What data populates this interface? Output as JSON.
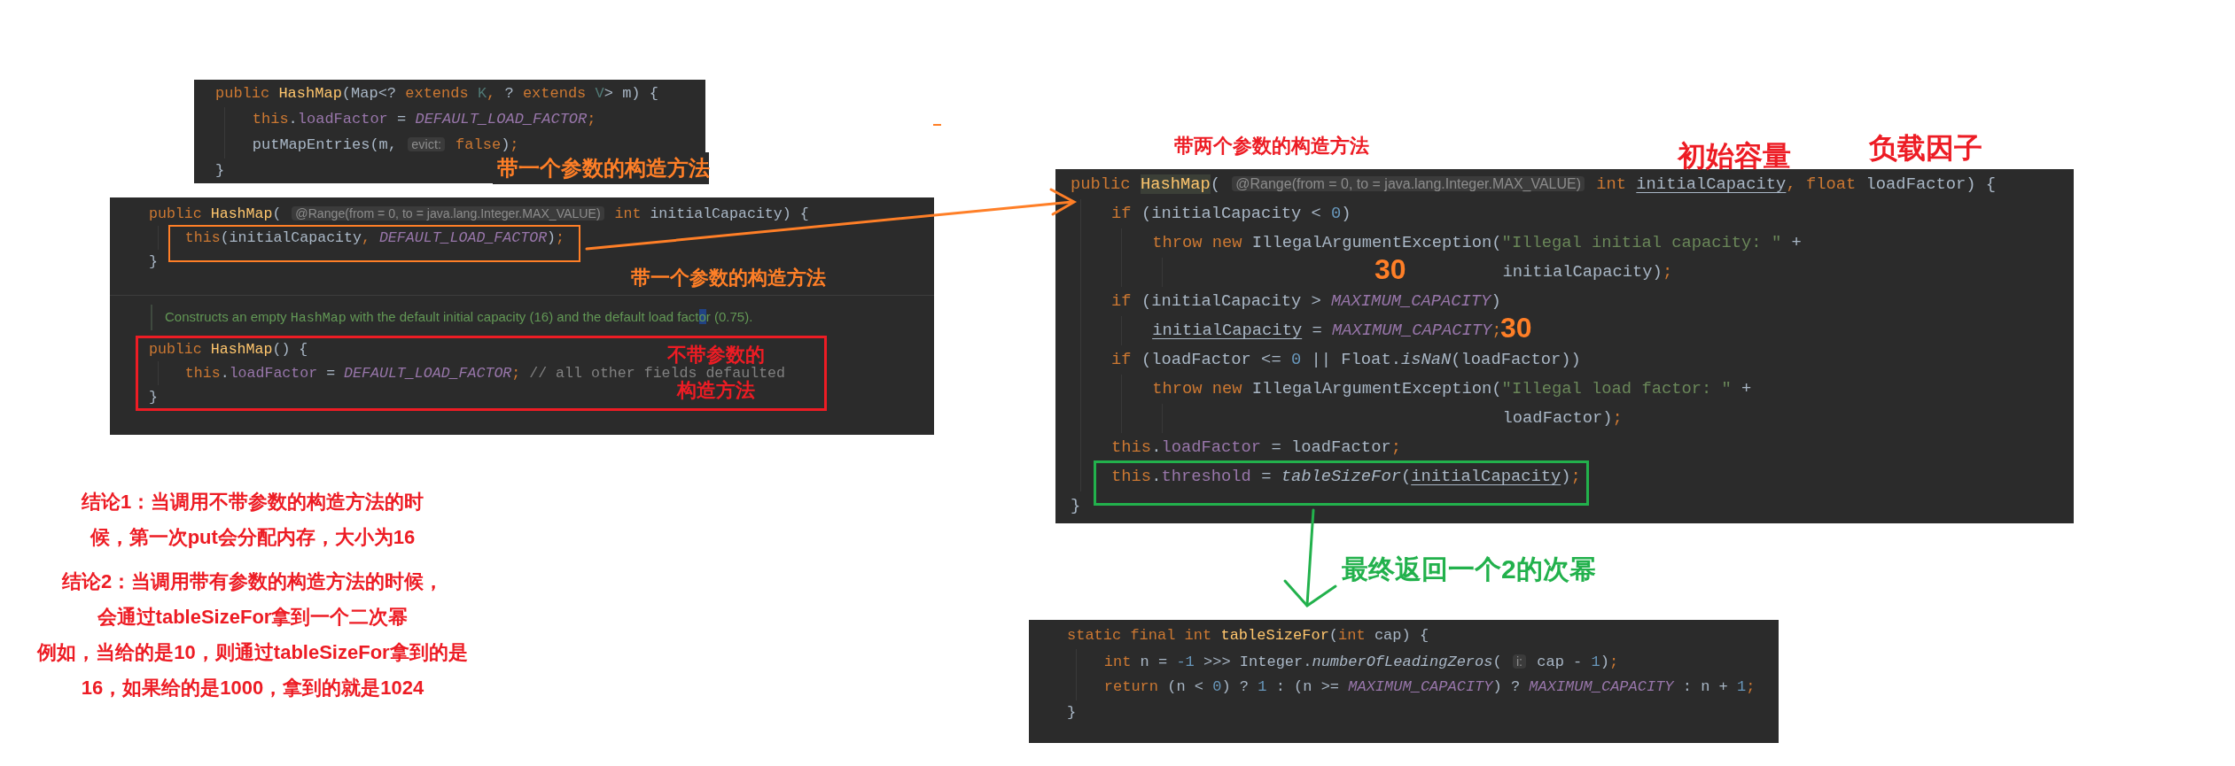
{
  "snippets": [
    {
      "lines": [
        {
          "kind": "code",
          "tokens": [
            {
              "kind": "keyword",
              "text": "public "
            },
            {
              "kind": "method",
              "text": "HashMap"
            },
            {
              "kind": "plain",
              "text": "(Map<? "
            },
            {
              "kind": "keyword",
              "text": "extends "
            },
            {
              "kind": "typeparam",
              "text": "K"
            },
            {
              "kind": "keyword",
              "text": ", "
            },
            {
              "kind": "plain",
              "text": "? "
            },
            {
              "kind": "keyword",
              "text": "extends "
            },
            {
              "kind": "typeparam",
              "text": "V"
            },
            {
              "kind": "plain",
              "text": "> m) {"
            }
          ],
          "children": [
            {
              "kind": "code",
              "tokens": [
                {
                  "kind": "keyword",
                  "text": "this"
                },
                {
                  "kind": "plain",
                  "text": "."
                },
                {
                  "kind": "field",
                  "text": "loadFactor"
                },
                {
                  "kind": "plain",
                  "text": " = "
                },
                {
                  "kind": "constant",
                  "text": "DEFAULT_LOAD_FACTOR"
                },
                {
                  "kind": "keyword",
                  "text": ";"
                }
              ]
            },
            {
              "kind": "code",
              "tokens": [
                {
                  "kind": "plain",
                  "text": "putMapEntries(m, "
                },
                {
                  "kind": "hint",
                  "text": "evict:"
                },
                {
                  "kind": "keyword",
                  "text": " false"
                },
                {
                  "kind": "plain",
                  "text": ")"
                },
                {
                  "kind": "keyword",
                  "text": ";"
                }
              ]
            }
          ]
        },
        {
          "kind": "code",
          "tokens": [
            {
              "kind": "plain",
              "text": "}"
            }
          ]
        }
      ]
    },
    {
      "lines": [
        {
          "kind": "code",
          "tokens": [
            {
              "kind": "keyword",
              "text": "public "
            },
            {
              "kind": "method",
              "text": "HashMap"
            },
            {
              "kind": "plain",
              "text": "( "
            },
            {
              "kind": "hint",
              "text": "@Range(from = 0, to = java.lang.Integer.MAX_VALUE)"
            },
            {
              "kind": "keyword",
              "text": " int"
            },
            {
              "kind": "plain",
              "text": " initialCapacity) {"
            }
          ],
          "children": [
            {
              "kind": "code",
              "tokens": [
                {
                  "kind": "keyword",
                  "text": "this"
                },
                {
                  "kind": "plain",
                  "text": "(initialCapacity"
                },
                {
                  "kind": "keyword",
                  "text": ", "
                },
                {
                  "kind": "constant",
                  "text": "DEFAULT_LOAD_FACTOR"
                },
                {
                  "kind": "plain",
                  "text": ")"
                },
                {
                  "kind": "keyword",
                  "text": ";"
                }
              ]
            }
          ]
        },
        {
          "kind": "code",
          "tokens": [
            {
              "kind": "plain",
              "text": "}"
            }
          ]
        },
        {
          "kind": "doc",
          "tokens": [
            {
              "kind": "doc",
              "text": "Constructs an empty "
            },
            {
              "kind": "doc_code",
              "text": "HashMap"
            },
            {
              "kind": "doc",
              "text": " with the default initial capacity (16) and the default load fact"
            },
            {
              "kind": "caret",
              "text": "o"
            },
            {
              "kind": "doc",
              "text": "r (0.75)."
            }
          ]
        },
        {
          "kind": "code",
          "tokens": [
            {
              "kind": "keyword",
              "text": "public "
            },
            {
              "kind": "method",
              "text": "HashMap"
            },
            {
              "kind": "plain",
              "text": "() {"
            }
          ],
          "children": [
            {
              "kind": "code",
              "tokens": [
                {
                  "kind": "keyword",
                  "text": "this"
                },
                {
                  "kind": "plain",
                  "text": "."
                },
                {
                  "kind": "field",
                  "text": "loadFactor"
                },
                {
                  "kind": "plain",
                  "text": " = "
                },
                {
                  "kind": "constant",
                  "text": "DEFAULT_LOAD_FACTOR"
                },
                {
                  "kind": "keyword",
                  "text": ";"
                },
                {
                  "kind": "comment",
                  "text": " // all other fields defaulted"
                }
              ]
            }
          ]
        },
        {
          "kind": "code",
          "tokens": [
            {
              "kind": "plain",
              "text": "}"
            }
          ]
        }
      ]
    },
    {
      "lines": [
        {
          "kind": "code",
          "tokens": [
            {
              "kind": "keyword",
              "text": "public "
            },
            {
              "kind": "method_highlight",
              "text": "HashMap"
            },
            {
              "kind": "plain",
              "text": "( "
            },
            {
              "kind": "hint",
              "text": "@Range(from = 0, to = java.lang.Integer.MAX_VALUE)"
            },
            {
              "kind": "keyword",
              "text": " int "
            },
            {
              "kind": "param",
              "text": "initialCapacity"
            },
            {
              "kind": "keyword",
              "text": ", float "
            },
            {
              "kind": "plain",
              "text": "loadFactor) {"
            }
          ],
          "children": [
            {
              "kind": "code",
              "tokens": [
                {
                  "kind": "keyword",
                  "text": "if "
                },
                {
                  "kind": "plain",
                  "text": "(initialCapacity < "
                },
                {
                  "kind": "number",
                  "text": "0"
                },
                {
                  "kind": "plain",
                  "text": ")"
                }
              ],
              "children": [
                {
                  "kind": "code",
                  "tokens": [
                    {
                      "kind": "keyword",
                      "text": "throw new "
                    },
                    {
                      "kind": "plain",
                      "text": "IllegalArgumentException("
                    },
                    {
                      "kind": "string",
                      "text": "\"Illegal initial capacity: \""
                    },
                    {
                      "kind": "plain",
                      "text": " +"
                    }
                  ],
                  "children": [
                    {
                      "kind": "continuation",
                      "tokens": [
                        {
                          "kind": "plain",
                          "text": "initialCapacity)"
                        },
                        {
                          "kind": "keyword",
                          "text": ";"
                        }
                      ]
                    }
                  ]
                }
              ]
            },
            {
              "kind": "code",
              "tokens": [
                {
                  "kind": "keyword",
                  "text": "if "
                },
                {
                  "kind": "plain",
                  "text": "(initialCapacity > "
                },
                {
                  "kind": "constant",
                  "text": "MAXIMUM_CAPACITY"
                },
                {
                  "kind": "plain",
                  "text": ")"
                }
              ],
              "children": [
                {
                  "kind": "code",
                  "tokens": [
                    {
                      "kind": "param",
                      "text": "initialCapacity"
                    },
                    {
                      "kind": "plain",
                      "text": " = "
                    },
                    {
                      "kind": "constant",
                      "text": "MAXIMUM_CAPACITY"
                    },
                    {
                      "kind": "keyword",
                      "text": ";"
                    }
                  ]
                }
              ]
            },
            {
              "kind": "code",
              "tokens": [
                {
                  "kind": "keyword",
                  "text": "if "
                },
                {
                  "kind": "plain",
                  "text": "(loadFactor <= "
                },
                {
                  "kind": "number",
                  "text": "0"
                },
                {
                  "kind": "plain",
                  "text": " || Float."
                },
                {
                  "kind": "static",
                  "text": "isNaN"
                },
                {
                  "kind": "plain",
                  "text": "(loadFactor))"
                }
              ],
              "children": [
                {
                  "kind": "code",
                  "tokens": [
                    {
                      "kind": "keyword",
                      "text": "throw new "
                    },
                    {
                      "kind": "plain",
                      "text": "IllegalArgumentException("
                    },
                    {
                      "kind": "string",
                      "text": "\"Illegal load factor: \""
                    },
                    {
                      "kind": "plain",
                      "text": " +"
                    }
                  ],
                  "children": [
                    {
                      "kind": "continuation",
                      "tokens": [
                        {
                          "kind": "plain",
                          "text": "loadFactor)"
                        },
                        {
                          "kind": "keyword",
                          "text": ";"
                        }
                      ]
                    }
                  ]
                }
              ]
            },
            {
              "kind": "code",
              "tokens": [
                {
                  "kind": "keyword",
                  "text": "this"
                },
                {
                  "kind": "plain",
                  "text": "."
                },
                {
                  "kind": "field",
                  "text": "loadFactor"
                },
                {
                  "kind": "plain",
                  "text": " = loadFactor"
                },
                {
                  "kind": "keyword",
                  "text": ";"
                }
              ]
            },
            {
              "kind": "code",
              "tokens": [
                {
                  "kind": "keyword",
                  "text": "this"
                },
                {
                  "kind": "plain",
                  "text": "."
                },
                {
                  "kind": "field",
                  "text": "threshold"
                },
                {
                  "kind": "plain",
                  "text": " = "
                },
                {
                  "kind": "static",
                  "text": "tableSizeFor"
                },
                {
                  "kind": "plain",
                  "text": "("
                },
                {
                  "kind": "param",
                  "text": "initialCapacity"
                },
                {
                  "kind": "plain",
                  "text": ")"
                },
                {
                  "kind": "keyword",
                  "text": ";"
                }
              ]
            }
          ]
        },
        {
          "kind": "code",
          "tokens": [
            {
              "kind": "plain",
              "text": "}"
            }
          ]
        }
      ]
    },
    {
      "lines": [
        {
          "kind": "code",
          "tokens": [
            {
              "kind": "keyword",
              "text": "static final int "
            },
            {
              "kind": "method",
              "text": "tableSizeFor"
            },
            {
              "kind": "plain",
              "text": "("
            },
            {
              "kind": "keyword",
              "text": "int "
            },
            {
              "kind": "plain",
              "text": "cap) {"
            }
          ],
          "children": [
            {
              "kind": "code",
              "tokens": [
                {
                  "kind": "keyword",
                  "text": "int "
                },
                {
                  "kind": "plain",
                  "text": "n = "
                },
                {
                  "kind": "number",
                  "text": "-1"
                },
                {
                  "kind": "plain",
                  "text": " >>> Integer."
                },
                {
                  "kind": "static",
                  "text": "numberOfLeadingZeros"
                },
                {
                  "kind": "plain",
                  "text": "( "
                },
                {
                  "kind": "hint",
                  "text": "i:"
                },
                {
                  "kind": "plain",
                  "text": " cap - "
                },
                {
                  "kind": "number",
                  "text": "1"
                },
                {
                  "kind": "plain",
                  "text": ")"
                },
                {
                  "kind": "keyword",
                  "text": ";"
                }
              ]
            },
            {
              "kind": "code",
              "tokens": [
                {
                  "kind": "keyword",
                  "text": "return "
                },
                {
                  "kind": "plain",
                  "text": "(n < "
                },
                {
                  "kind": "number",
                  "text": "0"
                },
                {
                  "kind": "plain",
                  "text": ") ? "
                },
                {
                  "kind": "number",
                  "text": "1"
                },
                {
                  "kind": "plain",
                  "text": " : (n >= "
                },
                {
                  "kind": "constant",
                  "text": "MAXIMUM_CAPACITY"
                },
                {
                  "kind": "plain",
                  "text": ") ? "
                },
                {
                  "kind": "constant",
                  "text": "MAXIMUM_CAPACITY"
                },
                {
                  "kind": "plain",
                  "text": " : n + "
                },
                {
                  "kind": "number",
                  "text": "1"
                },
                {
                  "kind": "keyword",
                  "text": ";"
                }
              ]
            }
          ]
        },
        {
          "kind": "code",
          "tokens": [
            {
              "kind": "plain",
              "text": "}"
            }
          ]
        }
      ]
    }
  ],
  "labels": [
    {
      "text": "带一个参数的构造方法",
      "color": "#ff7f27"
    },
    {
      "text": "带一个参数的构造方法",
      "color": "#ff7f27"
    },
    {
      "text": "不带参数的",
      "color": "#ed1c24"
    },
    {
      "text": "构造方法",
      "color": "#ed1c24"
    },
    {
      "text": "带两个参数的构造方法",
      "color": "#ed1c24"
    },
    {
      "text": "初始容量",
      "color": "#ed1c24"
    },
    {
      "text": "负载因子",
      "color": "#ed1c24"
    },
    {
      "text": "30",
      "color": "#ff7f27"
    },
    {
      "text": "30",
      "color": "#ff7f27"
    },
    {
      "text": "最终返回一个2的次幂",
      "color": "#22b14c"
    }
  ],
  "boxes": [
    {
      "color": "#ff7f27"
    },
    {
      "color": "#ed1c24"
    },
    {
      "color": "#22b14c"
    }
  ],
  "arrows": [
    {
      "color": "#ff7f27"
    },
    {
      "color": "#22b14c"
    }
  ],
  "marks": [
    {
      "color": "#ff7f27"
    }
  ],
  "conclusions": [
    {
      "lines": [
        "结论1：当调用不带参数的构造方法的时",
        "候，第一次put会分配内存，大小为16"
      ]
    },
    {
      "lines": [
        "结论2：当调用带有参数的构造方法的时候，",
        "会通过tableSizeFor拿到一个二次幂",
        "例如，当给的是10，则通过tableSizeFor拿到的是",
        "16，如果给的是1000，拿到的就是1024"
      ]
    }
  ]
}
